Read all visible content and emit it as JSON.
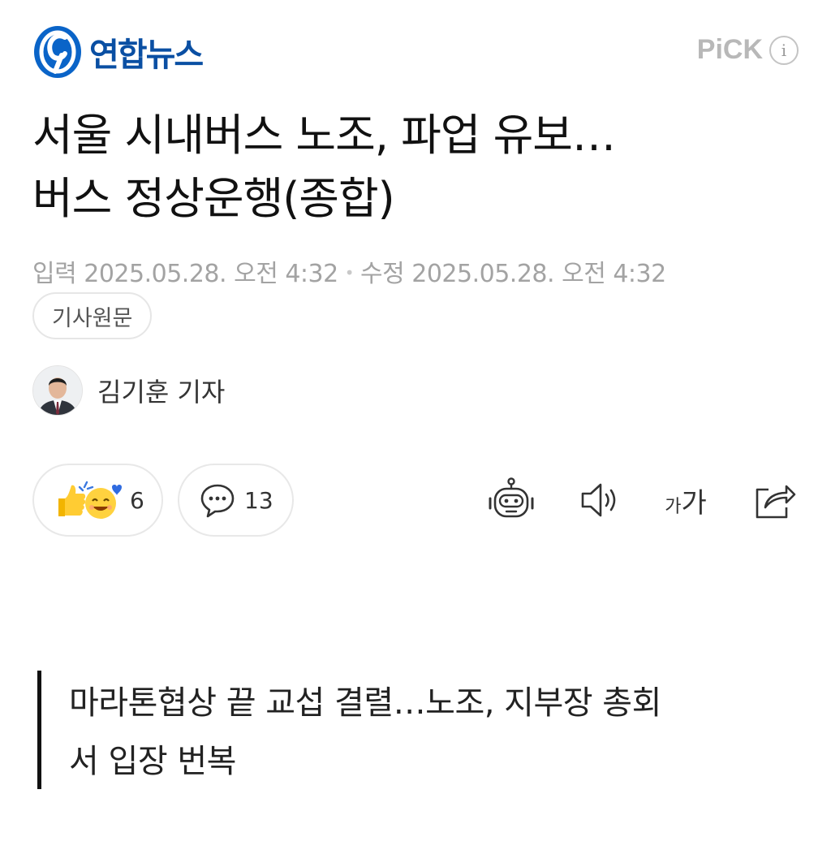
{
  "header": {
    "logo_text": "연합뉴스",
    "pick_label": "PiCK",
    "info_icon_label": "i"
  },
  "article": {
    "title_line1": "서울 시내버스 노조, 파업 유보…",
    "title_line2": "버스 정상운행(종합)",
    "input_label": "입력",
    "input_time": "2025.05.28. 오전 4:32",
    "separator": "•",
    "modified_label": "수정",
    "modified_time": "2025.05.28. 오전 4:32",
    "origin_button": "기사원문"
  },
  "reporter": {
    "name": "김기훈 기자"
  },
  "actions": {
    "reaction_count": "6",
    "comment_count": "13",
    "font_small": "가",
    "font_large": "가"
  },
  "summary": {
    "text_line1": "마라톤협상 끝 교섭 결렬…노조, 지부장 총회",
    "text_line2": "서 입장 번복"
  },
  "colors": {
    "brand_blue": "#0a4fa3",
    "pick_gray": "#b8b8b8",
    "meta_gray": "#a3a3a3"
  },
  "icons": [
    "yonhap-logo-icon",
    "info-icon",
    "reaction-emoji-icon",
    "comment-icon",
    "ai-bot-icon",
    "speaker-icon",
    "font-size-icon",
    "share-icon"
  ]
}
